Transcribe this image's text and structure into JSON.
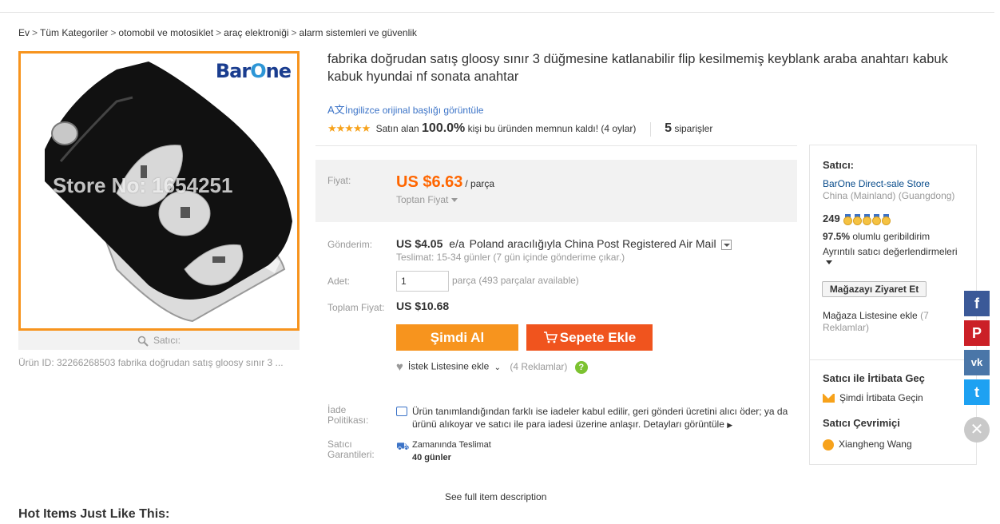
{
  "breadcrumb": [
    "Ev",
    "Tüm Kategoriler",
    "otomobil ve motosiklet",
    "araç elektroniği",
    "alarm sistemleri ve güvenlik"
  ],
  "gallery": {
    "logo_a": "Bar",
    "logo_b": "O",
    "logo_c": "ne",
    "watermark": "Store No: 1654251",
    "caption": "Satıcı:"
  },
  "product_id": "Ürün ID: 32266268503 fabrika doğrudan satış gloosy sınır 3 ...",
  "title": "fabrika doğrudan satış gloosy sınır 3 düğmesine katlanabilir flip kesilmemiş keyblank araba anahtarı kabuk kabuk hyundai nf sonata anahtar",
  "translate_link": "İngilizce orijinal başlığı görüntüle",
  "rating": {
    "stars": "★★★★★",
    "prefix": "Satın alan",
    "percent": "100.0%",
    "suffix": "kişi bu üründen memnun kaldı! (4 oylar)",
    "orders": "5",
    "orders_label": "siparişler"
  },
  "price": {
    "label": "Fiyat:",
    "amount": "US $6.63",
    "unit": "/ parça",
    "wholesale": "Toptan Fiyat"
  },
  "shipping": {
    "label": "Gönderim:",
    "cost": "US $4.05",
    "per": "e/a",
    "method": "Poland aracılığıyla China Post Registered Air Mail",
    "delivery": "Teslimat: 15-34 günler (7 gün içinde gönderime çıkar.)"
  },
  "quantity": {
    "label": "Adet:",
    "value": "1",
    "unit": "parça",
    "available": "(493 parçalar available)"
  },
  "total": {
    "label": "Toplam Fiyat:",
    "value": "US $10.68"
  },
  "buttons": {
    "buy": "Şimdi Al",
    "cart": "Sepete Ekle"
  },
  "wishlist": {
    "label": "İstek Listesine ekle",
    "count": "(4 Reklamlar)",
    "help": "?"
  },
  "returns": {
    "label": "İade Politikası:",
    "text": "Ürün tanımlandığından farklı ise iadeler kabul edilir, geri gönderi ücretini alıcı öder; ya da ürünü alıkoyar ve satıcı ile para iadesi üzerine anlaşır.",
    "more": "Detayları görüntüle"
  },
  "guarantee": {
    "label": "Satıcı Garantileri:",
    "title": "Zamanında Teslimat",
    "days": "40 günler"
  },
  "full_description": "See full item description",
  "hot_items": "Hot Items Just Like This:",
  "seller": {
    "heading": "Satıcı:",
    "store": "BarOne Direct-sale Store",
    "location": "China (Mainland) (Guangdong)",
    "score": "249",
    "feedback_pct": "97.5%",
    "feedback_label": "olumlu geribildirim",
    "details": "Ayrıntılı satıcı değerlendirmeleri",
    "visit_button": "Mağazayı Ziyaret Et",
    "add_list": "Mağaza Listesine ekle",
    "add_list_count": "(7 Reklamlar)",
    "contact_heading": "Satıcı ile İrtibata Geç",
    "contact_link": "Şimdi İrtibata Geçin",
    "online_heading": "Satıcı Çevrimiçi",
    "online_user": "Xiangheng Wang"
  },
  "social": {
    "facebook": "f",
    "pinterest": "P",
    "vk": "vk",
    "twitter": "t",
    "close": "✕"
  },
  "colors": {
    "accent_orange": "#f7941e",
    "cart_red": "#f0541e",
    "price_orange": "#ff6600",
    "link_blue": "#3b73c7"
  }
}
